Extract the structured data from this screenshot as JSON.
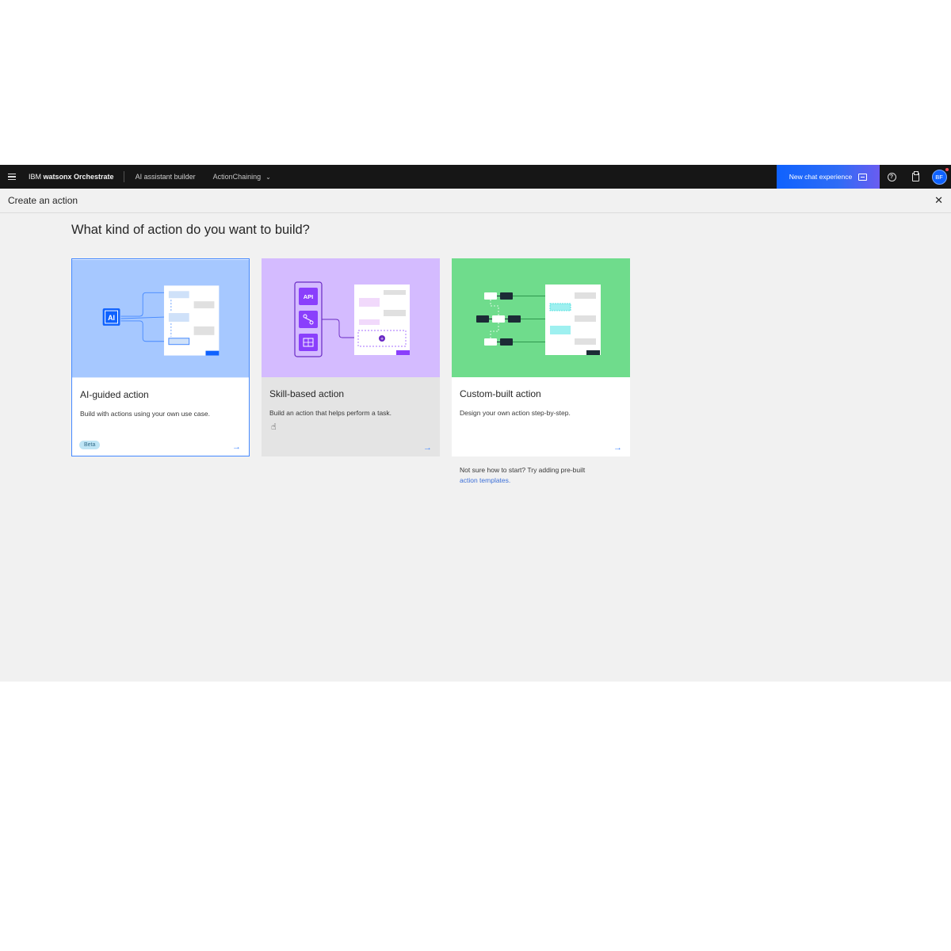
{
  "nav": {
    "brand_prefix": "IBM",
    "brand_name": "watsonx Orchestrate",
    "app_link": "AI assistant builder",
    "workspace": "ActionChaining",
    "new_chat": "New chat experience",
    "avatar_initials": "BF"
  },
  "page": {
    "title": "Create an action",
    "question": "What kind of action do you want to build?"
  },
  "cards": [
    {
      "title": "AI-guided action",
      "description": "Build with actions using your own use case.",
      "badge": "Beta",
      "accent": "#a6c8ff",
      "state": "selected"
    },
    {
      "title": "Skill-based action",
      "description": "Build an action that helps perform a task.",
      "accent": "#d4bbff",
      "state": "hover"
    },
    {
      "title": "Custom-built action",
      "description": "Design your own action step-by-step.",
      "accent": "#6fdc8c",
      "state": "default"
    }
  ],
  "hint": {
    "text": "Not sure how to start? Try adding pre-built",
    "link": "action templates."
  },
  "illustrations": {
    "ai_chip": "AI",
    "api_chip": "API"
  },
  "colors": {
    "nav_bg": "#161616",
    "page_bg": "#f1f1f1",
    "primary": "#0f62fe",
    "link": "#3d70d8"
  }
}
